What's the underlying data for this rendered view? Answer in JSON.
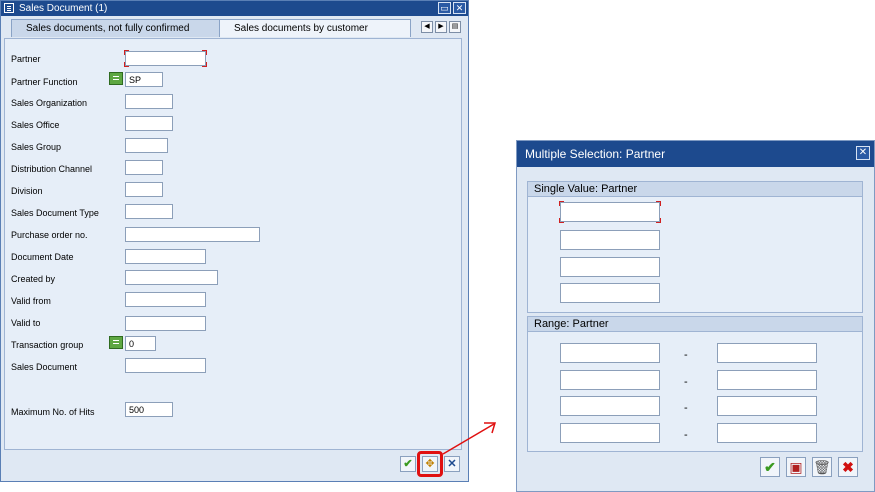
{
  "dialog1": {
    "title": "Sales Document (1)",
    "tabs": [
      {
        "label": "Sales documents, not fully confirmed"
      },
      {
        "label": "Sales documents by customer"
      }
    ],
    "fields": [
      {
        "label": "Partner",
        "value": ""
      },
      {
        "label": "Partner Function",
        "value": "SP"
      },
      {
        "label": "Sales Organization",
        "value": ""
      },
      {
        "label": "Sales Office",
        "value": ""
      },
      {
        "label": "Sales Group",
        "value": ""
      },
      {
        "label": "Distribution Channel",
        "value": ""
      },
      {
        "label": "Division",
        "value": ""
      },
      {
        "label": "Sales Document Type",
        "value": ""
      },
      {
        "label": "Purchase order no.",
        "value": ""
      },
      {
        "label": "Document Date",
        "value": ""
      },
      {
        "label": "Created by",
        "value": ""
      },
      {
        "label": "Valid from",
        "value": ""
      },
      {
        "label": "Valid to",
        "value": ""
      },
      {
        "label": "Transaction group",
        "value": "0"
      },
      {
        "label": "Sales Document",
        "value": ""
      },
      {
        "label": "Maximum No. of Hits",
        "value": "500"
      }
    ],
    "toolbar_icons": [
      "checkmark-icon",
      "multiple-selection-icon",
      "cancel-icon"
    ]
  },
  "dialog2": {
    "title": "Multiple Selection: Partner",
    "single_value_header": "Single Value: Partner",
    "single_values": [
      "",
      "",
      "",
      ""
    ],
    "range_header": "Range: Partner",
    "ranges": [
      {
        "from": "",
        "to": "",
        "separator": "-"
      },
      {
        "from": "",
        "to": "",
        "separator": "-"
      },
      {
        "from": "",
        "to": "",
        "separator": "-"
      },
      {
        "from": "",
        "to": "",
        "separator": "-"
      }
    ],
    "toolbar_icons": [
      "checkmark-icon",
      "save-icon",
      "delete-icon",
      "cancel-icon"
    ]
  },
  "colors": {
    "title_bar": "#1d4a8e",
    "highlight": "#e01010",
    "confirm_green": "#3a9a20",
    "cancel_red": "#d01010"
  }
}
